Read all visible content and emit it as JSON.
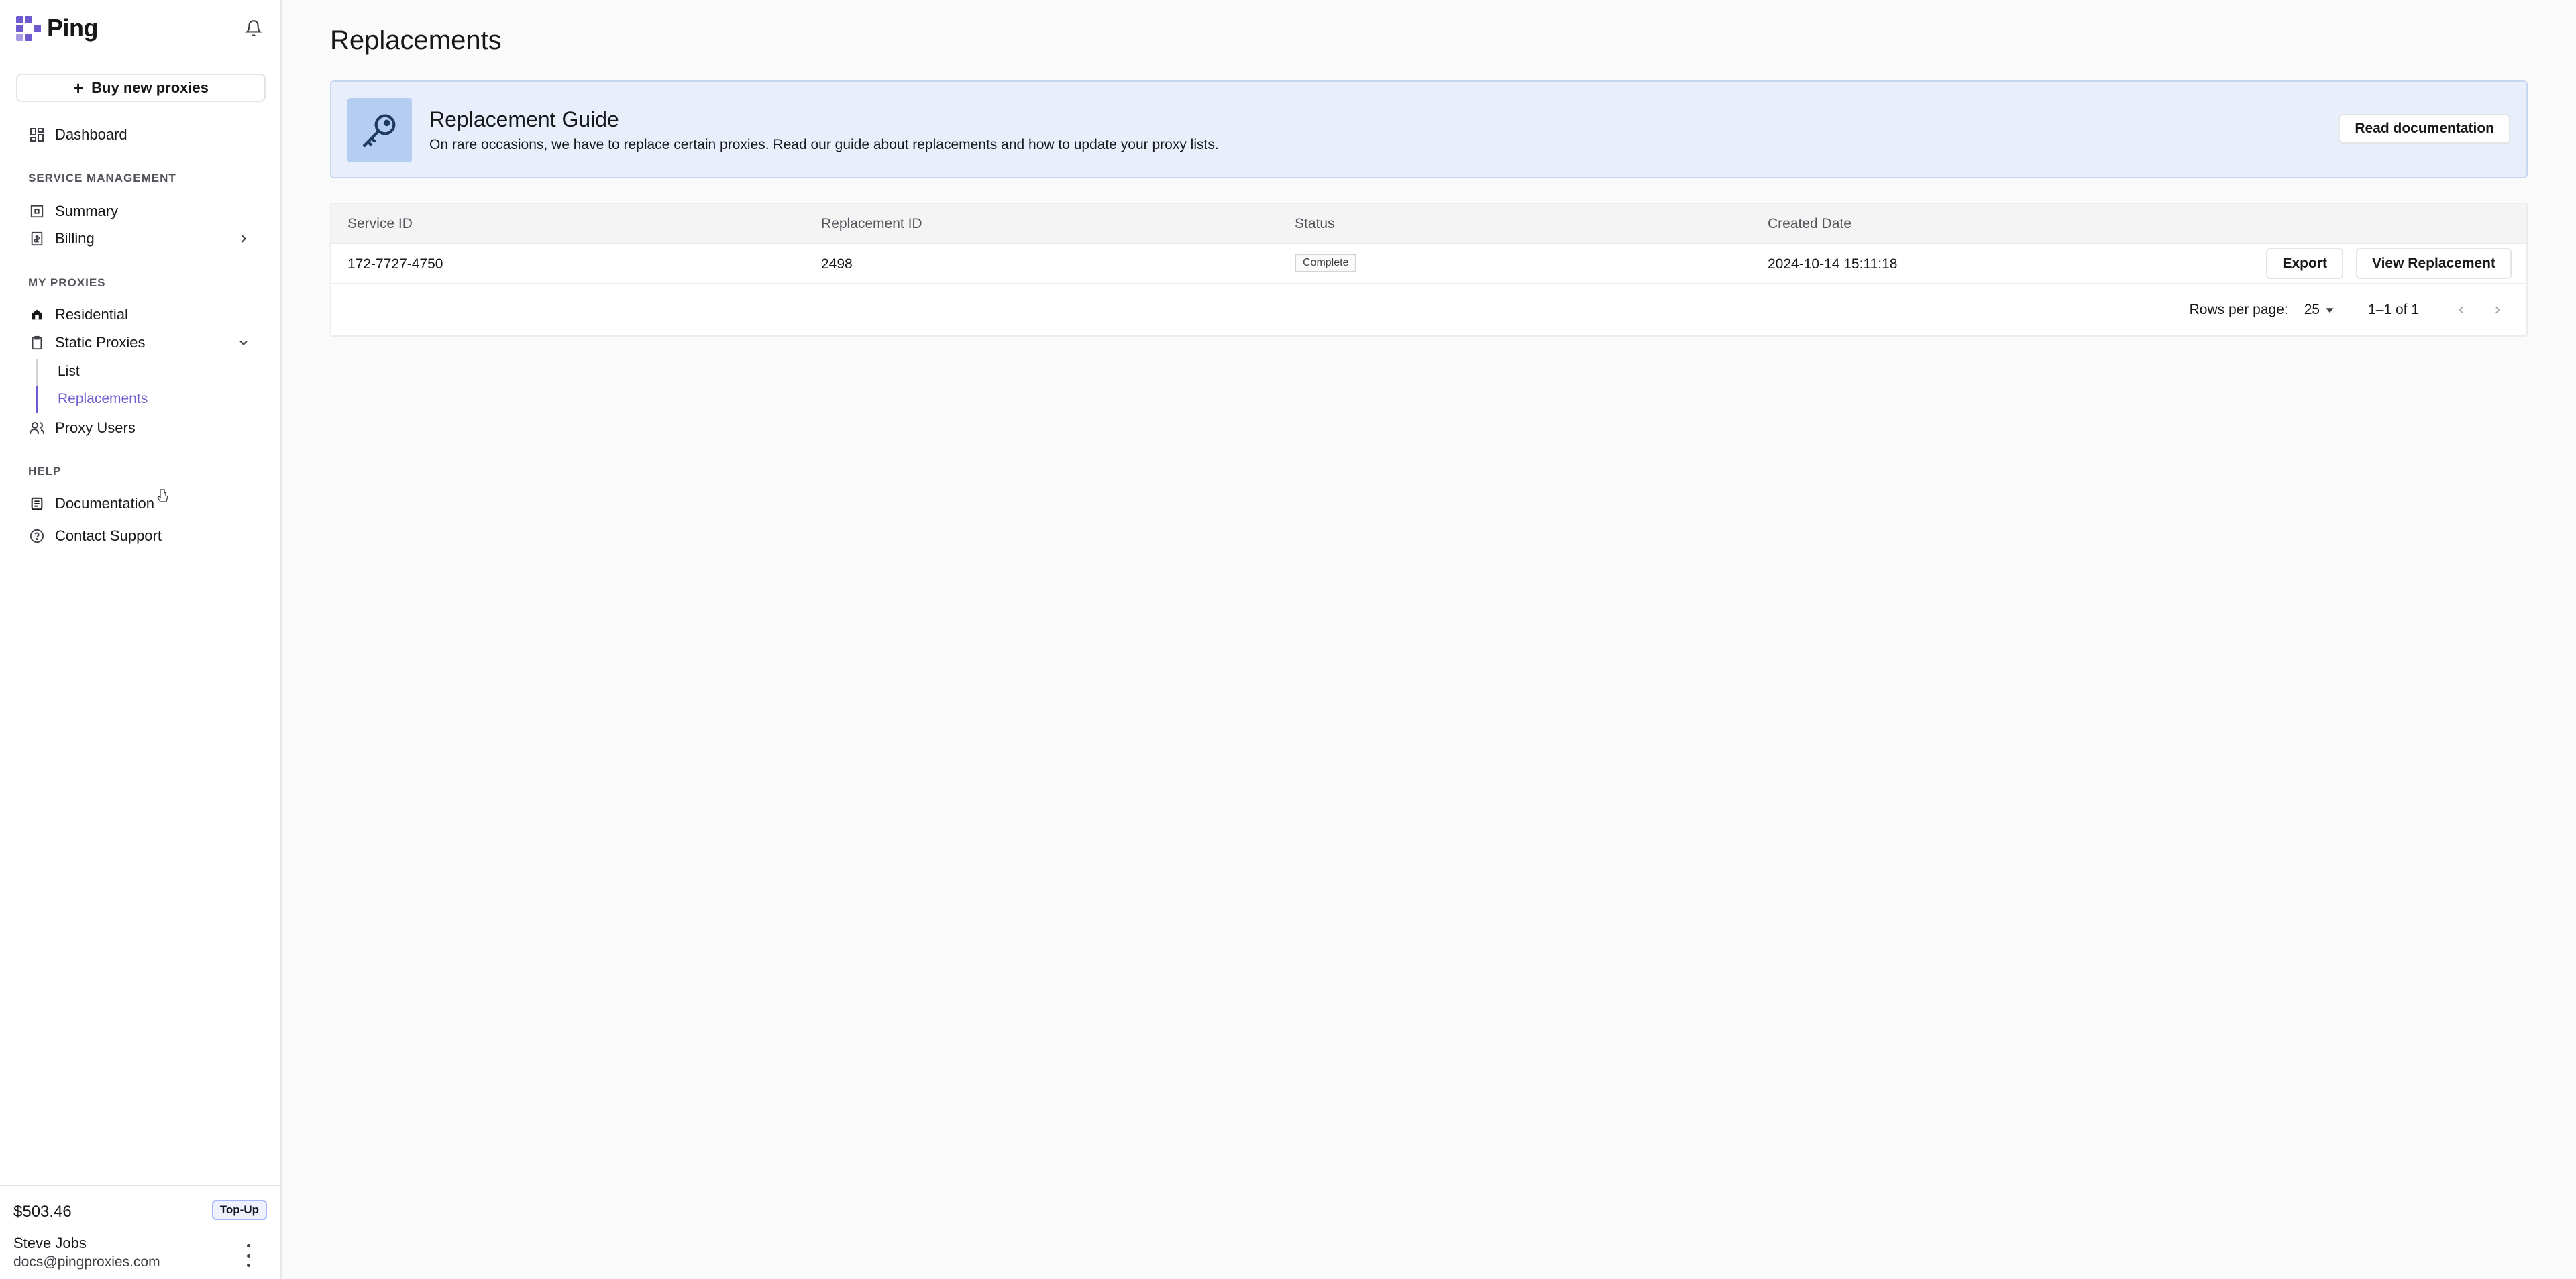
{
  "app": {
    "name": "Ping",
    "brand_color": "#6d5bd0"
  },
  "sidebar": {
    "buy_button": "Buy new proxies",
    "dashboard": "Dashboard",
    "section_service": "SERVICE MANAGEMENT",
    "summary": "Summary",
    "billing": "Billing",
    "section_proxies": "MY PROXIES",
    "residential": "Residential",
    "static_proxies": "Static Proxies",
    "sub_list": "List",
    "sub_replacements": "Replacements",
    "proxy_users": "Proxy Users",
    "section_help": "HELP",
    "documentation": "Documentation",
    "contact_support": "Contact Support",
    "balance": "$503.46",
    "topup": "Top-Up",
    "user_name": "Steve Jobs",
    "user_email": "docs@pingproxies.com"
  },
  "main": {
    "title": "Replacements",
    "guide": {
      "title": "Replacement Guide",
      "description": "On rare occasions, we have to replace certain proxies. Read our guide about replacements and how to update your proxy lists.",
      "button": "Read documentation"
    },
    "table": {
      "columns": [
        "Service ID",
        "Replacement ID",
        "Status",
        "Created Date"
      ],
      "rows": [
        {
          "service_id": "172-7727-4750",
          "replacement_id": "2498",
          "status": "Complete",
          "created_date": "2024-10-14 15:11:18",
          "export_label": "Export",
          "view_label": "View Replacement"
        }
      ]
    },
    "pagination": {
      "rows_per_page_label": "Rows per page:",
      "rows_per_page_value": "25",
      "range": "1–1 of 1"
    }
  }
}
